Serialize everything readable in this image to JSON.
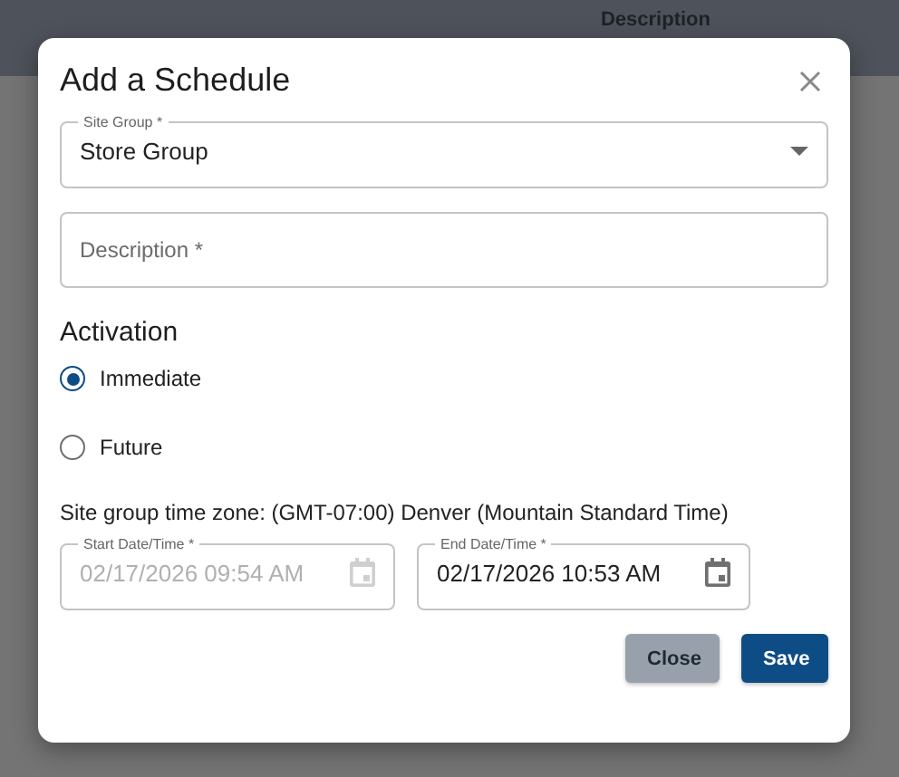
{
  "background": {
    "column_header": "Description"
  },
  "dialog": {
    "title": "Add a Schedule",
    "fields": [
      {
        "kind": "select",
        "label": "Site Group *",
        "value": "Store Group"
      },
      {
        "kind": "text",
        "placeholder": "Description *"
      }
    ],
    "activation": {
      "heading": "Activation",
      "options": [
        {
          "label": "Immediate",
          "selected": true
        },
        {
          "label": "Future",
          "selected": false
        }
      ]
    },
    "timezone": "Site group time zone: (GMT-07:00) Denver (Mountain Standard Time)",
    "dates": [
      {
        "label": "Start Date/Time *",
        "value": "02/17/2026 09:54 AM",
        "disabled": true
      },
      {
        "label": "End Date/Time *",
        "value": "02/17/2026 10:53 AM",
        "disabled": false
      }
    ],
    "buttons": [
      {
        "label": "Close",
        "kind": "secondary"
      },
      {
        "label": "Save",
        "kind": "primary"
      }
    ]
  }
}
